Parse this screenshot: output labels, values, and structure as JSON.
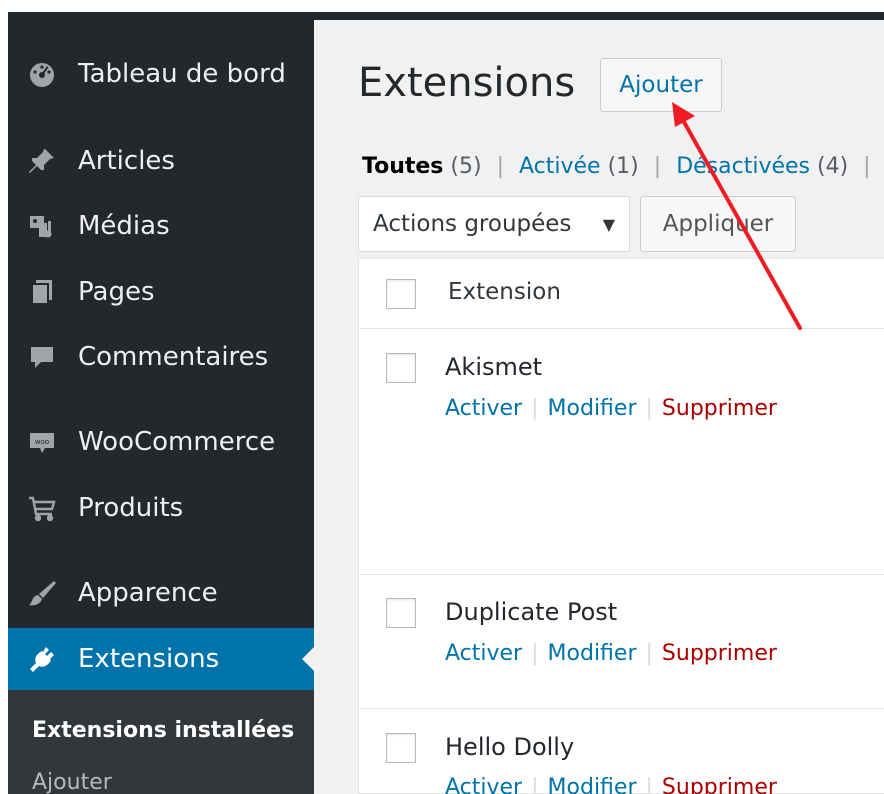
{
  "sidebar": {
    "items": [
      {
        "label": "Tableau de bord",
        "icon": "dashboard-icon"
      },
      {
        "label": "Articles",
        "icon": "pin-icon"
      },
      {
        "label": "Médias",
        "icon": "media-icon"
      },
      {
        "label": "Pages",
        "icon": "pages-icon"
      },
      {
        "label": "Commentaires",
        "icon": "comment-icon"
      },
      {
        "label": "WooCommerce",
        "icon": "woocommerce-icon"
      },
      {
        "label": "Produits",
        "icon": "cart-icon"
      },
      {
        "label": "Apparence",
        "icon": "brush-icon"
      },
      {
        "label": "Extensions",
        "icon": "plugin-icon"
      }
    ],
    "submenu": [
      {
        "label": "Extensions installées"
      },
      {
        "label": "Ajouter"
      }
    ]
  },
  "header": {
    "title": "Extensions",
    "add_button": "Ajouter"
  },
  "filters": {
    "all_label": "Toutes",
    "all_count": "(5)",
    "active_label": "Activée",
    "active_count": "(1)",
    "inactive_label": "Désactivées",
    "inactive_count": "(4)",
    "separator": "|"
  },
  "bulk": {
    "select_label": "Actions groupées",
    "apply_label": "Appliquer"
  },
  "table": {
    "column_header": "Extension",
    "rows": [
      {
        "name": "Akismet",
        "activate": "Activer",
        "edit": "Modifier",
        "delete": "Supprimer"
      },
      {
        "name": "Duplicate Post",
        "activate": "Activer",
        "edit": "Modifier",
        "delete": "Supprimer"
      },
      {
        "name": "Hello Dolly",
        "activate": "Activer",
        "edit": "Modifier",
        "delete": "Supprimer"
      }
    ]
  },
  "colors": {
    "sidebar_bg": "#23282d",
    "accent": "#0073aa",
    "delete": "#aa0000",
    "annotation_arrow": "#ee1c25"
  }
}
